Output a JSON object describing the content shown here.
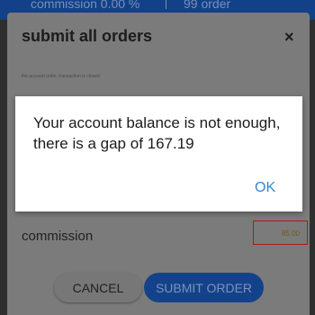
{
  "background": {
    "banner_left": "commission 0.00 %",
    "banner_right": "99 order"
  },
  "sheet": {
    "title": "submit all orders",
    "close_glyph": "×",
    "note": "the account order, transaction is closed",
    "commission_label": "commission",
    "commission_value": "85.00",
    "cancel_label": "CANCEL",
    "submit_label": "SUBMIT ORDER"
  },
  "alert": {
    "message": "Your account balance is not enough, there is a gap of 167.19",
    "ok_label": "OK"
  },
  "colors": {
    "accent_blue": "#14428a",
    "ok_text": "#3a87c8",
    "highlight_border": "#b01616"
  }
}
